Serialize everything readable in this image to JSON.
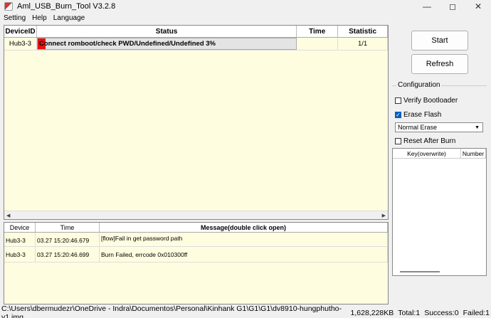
{
  "window": {
    "title": "Aml_USB_Burn_Tool V3.2.8"
  },
  "menu": [
    "Setting",
    "Help",
    "Language"
  ],
  "device_table": {
    "columns": [
      "DeviceID",
      "Status",
      "Time",
      "Statistic"
    ],
    "rows": [
      {
        "device_id": "Hub3-3",
        "status": "Connect romboot/check PWD/Undefined/Undefined 3%",
        "progress_percent": 3,
        "time": "",
        "statistic": "1/1"
      }
    ]
  },
  "log_table": {
    "columns": [
      "Device",
      "Time",
      "Message(double click open)"
    ],
    "rows": [
      {
        "device": "Hub3-3",
        "time": "03.27 15:20:46.679",
        "message": "[flow]Fail in get password path"
      },
      {
        "device": "Hub3-3",
        "time": "03.27 15:20:46.699",
        "message": "Burn Failed, errcode 0x010300ff"
      }
    ]
  },
  "controls": {
    "start_label": "Start",
    "refresh_label": "Refresh"
  },
  "configuration": {
    "label": "Configuration",
    "verify_bootloader": {
      "label": "Verify Bootloader",
      "checked": false
    },
    "erase_flash": {
      "label": "Erase Flash",
      "checked": true
    },
    "erase_mode": "Normal Erase",
    "reset_after_burn": {
      "label": "Reset After Burn",
      "checked": false
    },
    "key_table_columns": [
      "Key(overwrite)",
      "Number"
    ]
  },
  "statusbar": {
    "image_path": "C:\\Users\\dbermudezr\\OneDrive - Indra\\Documentos\\Personal\\Kinhank G1\\G1\\G1\\dv8910-hungphutho-v1.img",
    "size": "1,628,228KB",
    "total": "Total:1",
    "success": "Success:0",
    "failed": "Failed:1"
  },
  "colors": {
    "progress": "#e81010",
    "table_bg": "#fffde0",
    "accent": "#0060c0"
  }
}
